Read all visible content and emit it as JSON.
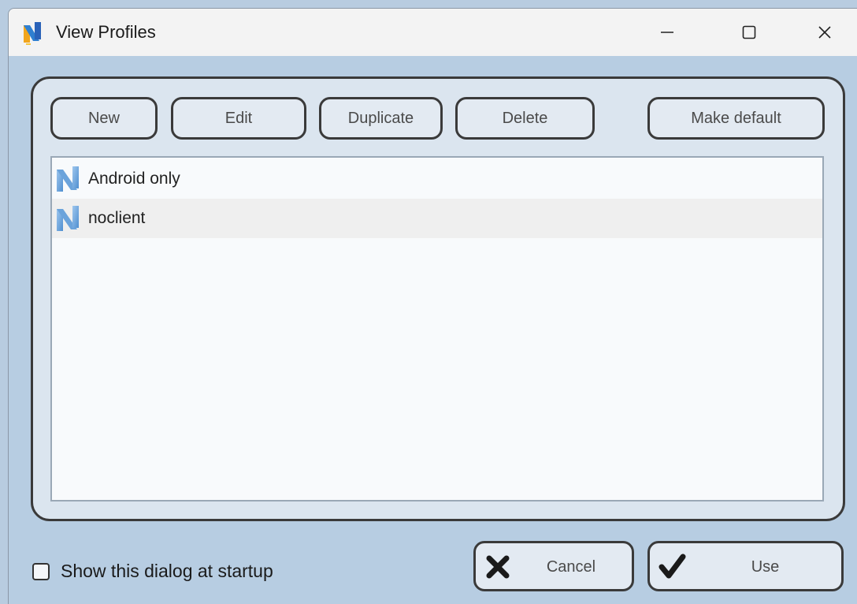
{
  "window": {
    "title": "View Profiles",
    "controls": {
      "minimize_icon": "minimize-icon",
      "maximize_icon": "maximize-icon",
      "close_icon": "close-icon"
    }
  },
  "toolbar": {
    "new_label": "New",
    "edit_label": "Edit",
    "duplicate_label": "Duplicate",
    "delete_label": "Delete",
    "make_default_label": "Make default"
  },
  "profiles": {
    "items": [
      {
        "label": "Android only",
        "icon": "profile-n-icon",
        "selected": false
      },
      {
        "label": "noclient",
        "icon": "profile-n-icon",
        "selected": true
      }
    ]
  },
  "footer": {
    "startup_checkbox_label": "Show this dialog at startup",
    "startup_checkbox_checked": false,
    "cancel_label": "Cancel",
    "use_label": "Use"
  },
  "colors": {
    "window_bg": "#b7cde2",
    "panel_bg": "#dbe5ef",
    "border": "#3a3a3a",
    "selected_row": "#efefef"
  }
}
